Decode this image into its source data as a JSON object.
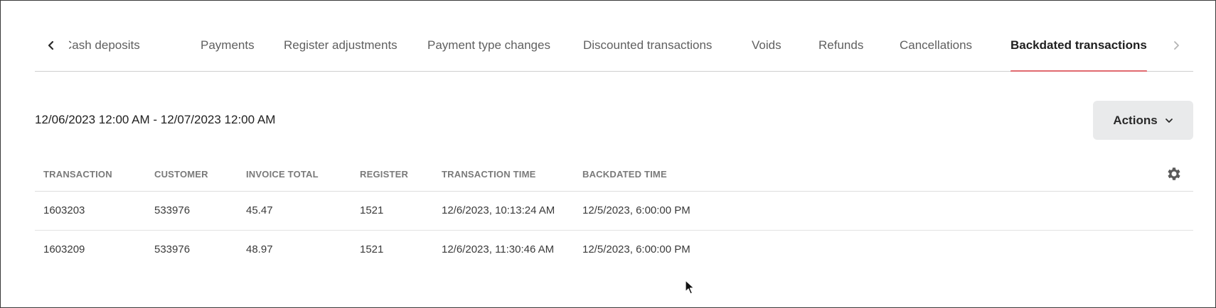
{
  "tabs": [
    {
      "label": "Cash deposits",
      "visible_label": "Cash deposits",
      "active": false
    },
    {
      "label": "Payments",
      "active": false
    },
    {
      "label": "Register adjustments",
      "active": false
    },
    {
      "label": "Payment type changes",
      "active": false
    },
    {
      "label": "Discounted transactions",
      "active": false
    },
    {
      "label": "Voids",
      "active": false
    },
    {
      "label": "Refunds",
      "active": false
    },
    {
      "label": "Cancellations",
      "active": false
    },
    {
      "label": "Backdated transactions",
      "active": true
    }
  ],
  "date_range": "12/06/2023 12:00 AM - 12/07/2023 12:00 AM",
  "actions_label": "Actions",
  "table": {
    "columns": [
      "TRANSACTION",
      "CUSTOMER",
      "INVOICE TOTAL",
      "REGISTER",
      "TRANSACTION TIME",
      "BACKDATED TIME"
    ],
    "rows": [
      [
        "1603203",
        "533976",
        "45.47",
        "1521",
        "12/6/2023, 10:13:24 AM",
        "12/5/2023, 6:00:00 PM"
      ],
      [
        "1603209",
        "533976",
        "48.97",
        "1521",
        "12/6/2023, 11:30:46 AM",
        "12/5/2023, 6:00:00 PM"
      ]
    ]
  },
  "colors": {
    "active_tab_underline": "#e06a6f",
    "actions_button_bg": "#e9eaeb"
  },
  "icons": {
    "tab_prev": "chevron-left-icon",
    "tab_next": "chevron-right-icon",
    "actions": "chevron-down-icon",
    "settings": "gear-icon"
  }
}
